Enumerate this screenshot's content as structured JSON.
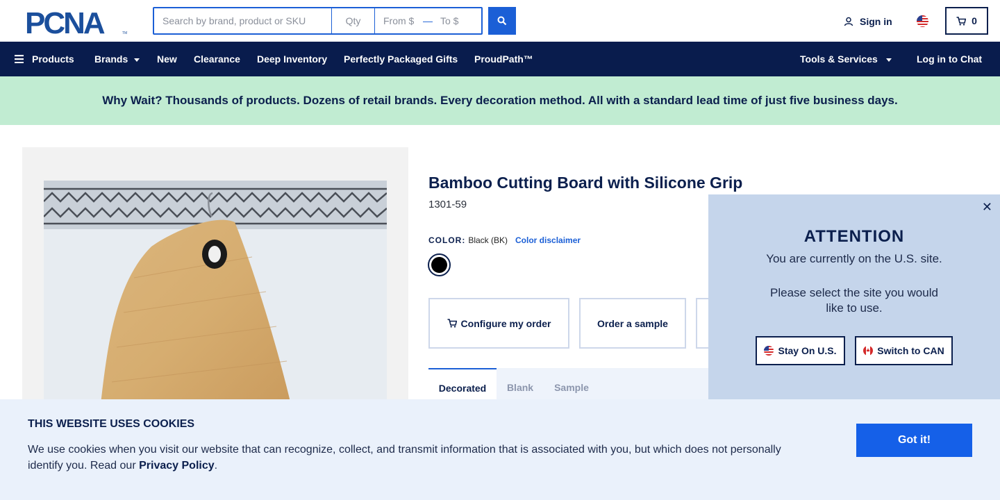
{
  "header": {
    "logo_text": "PCNA",
    "search_placeholder": "Search by brand, product or SKU",
    "qty_placeholder": "Qty",
    "from_placeholder": "From $",
    "to_placeholder": "To $",
    "signin_label": "Sign in",
    "cart_count": "0"
  },
  "nav": {
    "products": "Products",
    "brands": "Brands",
    "new": "New",
    "clearance": "Clearance",
    "deep_inventory": "Deep Inventory",
    "gifts": "Perfectly Packaged Gifts",
    "proudpath": "ProudPath™",
    "tools": "Tools & Services",
    "chat": "Log in to Chat"
  },
  "promo": "Why Wait? Thousands of products. Dozens of retail brands. Every decoration method. All with a standard lead time of just five business days.",
  "product": {
    "title": "Bamboo Cutting Board with Silicone Grip",
    "sku": "1301-59",
    "color_label": "COLOR:",
    "color_value": "Black (BK)",
    "color_disclaimer": "Color disclaimer",
    "swatch_color": "#000000",
    "configure": "Configure my order",
    "sample": "Order a sample",
    "tabs": [
      "Decorated",
      "Blank",
      "Sample"
    ]
  },
  "attention": {
    "title": "ATTENTION",
    "line1": "You are currently on the U.S. site.",
    "line2": "Please select the site you would like to use.",
    "stay": "Stay On U.S.",
    "switch": "Switch to CAN"
  },
  "cookies": {
    "title": "THIS WEBSITE USES COOKIES",
    "text": "We use cookies when you visit our website that can recognize, collect, and transmit information that is associated with you, but which does not personally identify you. Read our",
    "link": "Privacy Policy",
    "period": ".",
    "button": "Got it!"
  },
  "colors": {
    "navy": "#091c4d",
    "blue": "#1b5fd6",
    "promo_bg": "#c1ecd2"
  }
}
